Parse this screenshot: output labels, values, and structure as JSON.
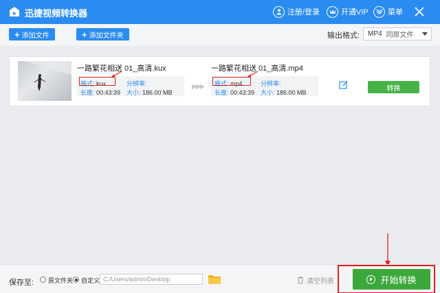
{
  "titlebar": {
    "title": "迅捷视频转换器",
    "login_label": "注册/登录",
    "vip_label": "开通VIP",
    "menu_label": "菜单"
  },
  "toolbar": {
    "add_file_label": "添加文件",
    "add_folder_label": "添加文件夹",
    "output_format_label": "输出格式:",
    "format_value": "MP4",
    "format_sub": "同原文件"
  },
  "file": {
    "source": {
      "name": "一路繁花相送 01_高清.kux",
      "format_label": "格式:",
      "format_value": "kux",
      "resolution_label": "分辨率:",
      "duration_label": "长度:",
      "duration_value": "00:43:39",
      "size_label": "大小:",
      "size_value": "186.00 MB"
    },
    "target": {
      "name": "一路繁花相送 01_高清.mp4",
      "format_label": "格式:",
      "format_value": "mp4",
      "resolution_label": "分辨率:",
      "duration_label": "长度:",
      "duration_value": "00:43:39",
      "size_label": "大小:",
      "size_value": "186.00 MB"
    },
    "convert_label": "转换"
  },
  "bottombar": {
    "save_to_label": "保存至:",
    "option_original": "原文件夹",
    "option_custom": "自定义",
    "path_value": "C:/Users/admin/Desktop",
    "clear_label": "清空列表",
    "start_label": "开始转换"
  },
  "colors": {
    "primary_blue": "#2a8cf0",
    "green": "#3ba83b",
    "highlight_red": "#e02020"
  }
}
